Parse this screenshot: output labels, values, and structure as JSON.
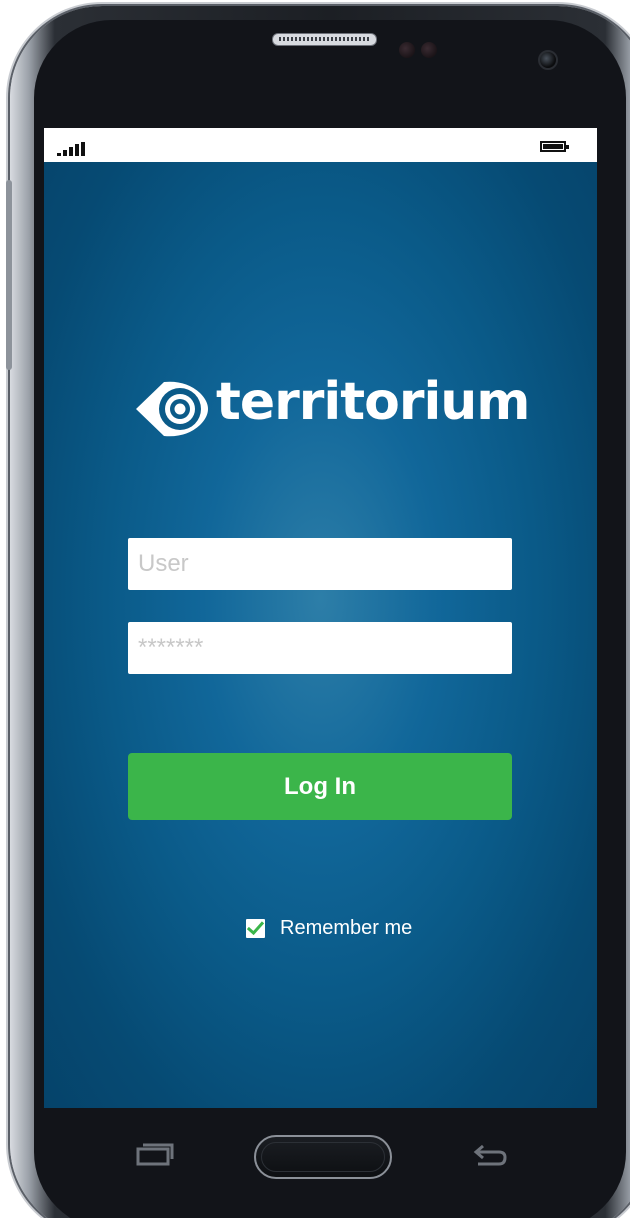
{
  "app": {
    "brand_name": "territorium",
    "brand_color": "#ffffff",
    "background_color": "#0a5a88"
  },
  "status_bar": {
    "signal_icon": "signal-bars-icon",
    "battery_icon": "battery-full-icon"
  },
  "login_form": {
    "user_placeholder": "User",
    "user_value": "",
    "password_placeholder": "*******",
    "password_value": "",
    "login_label": "Log In",
    "login_color": "#3bb54a",
    "remember_label": "Remember me",
    "remember_checked": true,
    "check_color": "#3bb54a"
  },
  "nav_bar": {
    "recent_icon": "recent-apps-icon",
    "home_button": "home-button",
    "back_icon": "back-icon"
  }
}
